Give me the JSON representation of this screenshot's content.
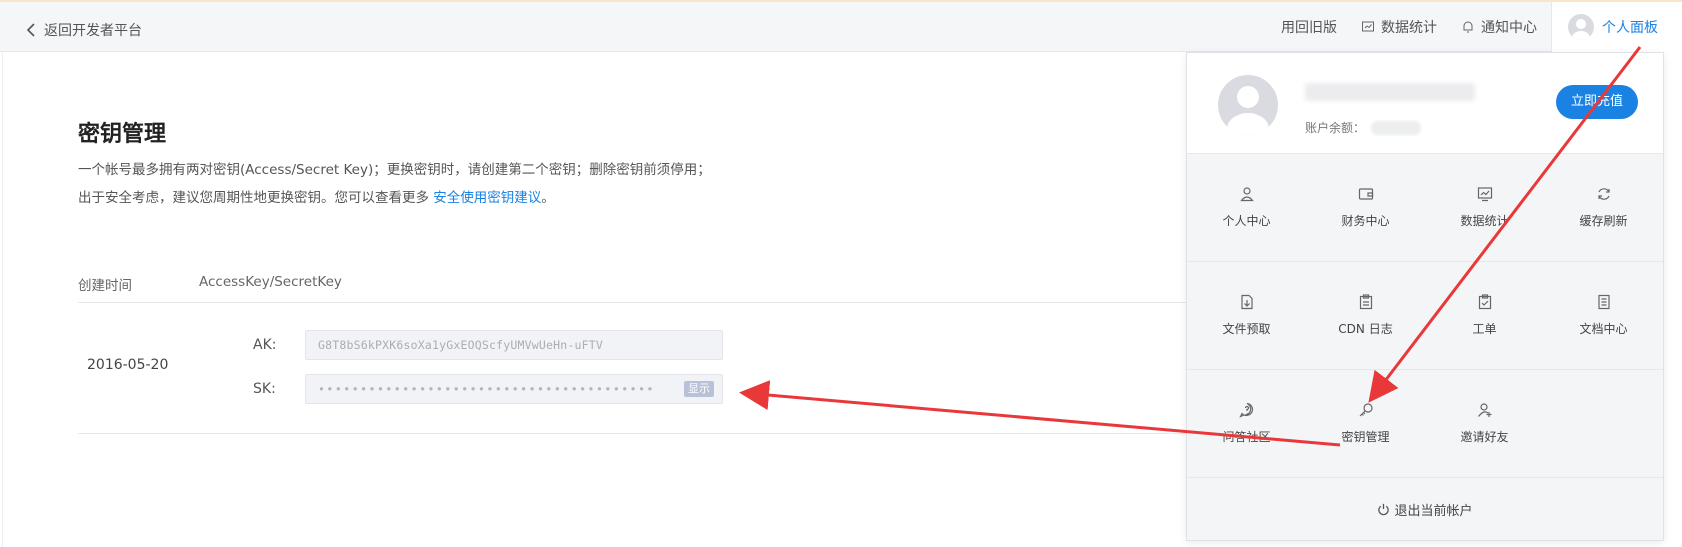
{
  "header": {
    "back_label": "返回开发者平台",
    "nav": {
      "old_version": "用回旧版",
      "data_stats": "数据统计",
      "notifications": "通知中心",
      "personal_panel": "个人面板"
    }
  },
  "main": {
    "title": "密钥管理",
    "description_part1": "一个帐号最多拥有两对密钥(Access/Secret Key)；更换密钥时，请创建第二个密钥；删除密钥前须停用；出于安全考虑，建议您周期性地更换密钥。您可以查看更多 ",
    "description_link": "安全使用密钥建议",
    "description_end": "。",
    "table": {
      "col_time": "创建时间",
      "col_key": "AccessKey/SecretKey",
      "row": {
        "date": "2016-05-20",
        "ak_label": "AK:",
        "ak_value": "G8T8bS6kPXK6soXa1yGxEOQScfyUMVwUeHn-uFTV",
        "sk_label": "SK:",
        "sk_value": "••••••••••••••••••••••••••••••••••••••••",
        "show_label": "显示"
      }
    }
  },
  "panel": {
    "balance_label": "账户余额：",
    "recharge_label": "立即充值",
    "grid": [
      [
        {
          "label": "个人中心",
          "icon": "user-icon"
        },
        {
          "label": "财务中心",
          "icon": "wallet-icon"
        },
        {
          "label": "数据统计",
          "icon": "chart-icon"
        },
        {
          "label": "缓存刷新",
          "icon": "refresh-icon"
        }
      ],
      [
        {
          "label": "文件预取",
          "icon": "file-download-icon"
        },
        {
          "label": "CDN 日志",
          "icon": "clipboard-icon"
        },
        {
          "label": "工单",
          "icon": "checklist-icon"
        },
        {
          "label": "文档中心",
          "icon": "document-icon"
        }
      ],
      [
        {
          "label": "问答社区",
          "icon": "question-icon"
        },
        {
          "label": "密钥管理",
          "icon": "key-icon"
        },
        {
          "label": "邀请好友",
          "icon": "invite-icon"
        }
      ]
    ],
    "logout_label": "退出当前帐户"
  },
  "colors": {
    "accent": "#1a82e2",
    "annotation_arrow": "#e8383a"
  }
}
